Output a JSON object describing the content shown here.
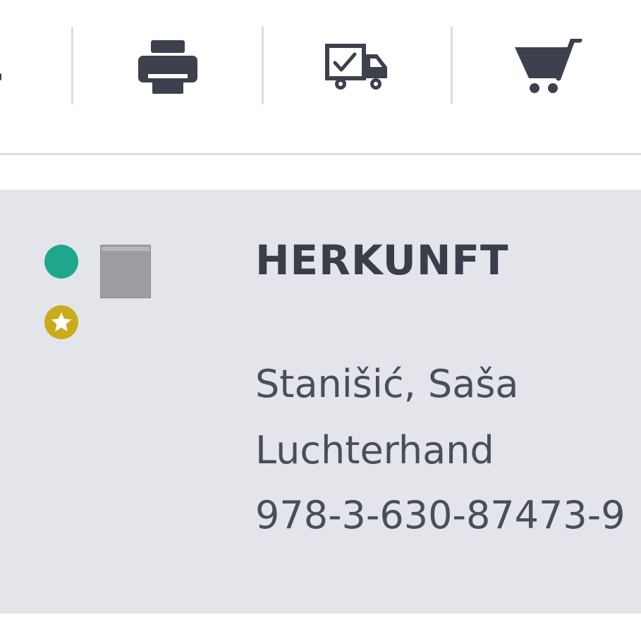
{
  "toolbar": {
    "actions": [
      {
        "name": "print",
        "icon": "printer-icon"
      },
      {
        "name": "delivery",
        "icon": "delivery-truck-check-icon"
      },
      {
        "name": "cart",
        "icon": "shopping-cart-icon"
      }
    ],
    "icon_color": "#3d414d"
  },
  "item": {
    "title": "HERKUNFT",
    "author": "Stanišić, Saša",
    "publisher": "Luchterhand",
    "isbn": "978-3-630-87473-9",
    "availability_color": "#1fa78e",
    "featured_badge_color": "#c9ac1b",
    "media_icon": "book-icon"
  },
  "colors": {
    "panel_background": "#e4e5ea",
    "text": "#3a3e4a",
    "separator": "#dcdde2"
  }
}
